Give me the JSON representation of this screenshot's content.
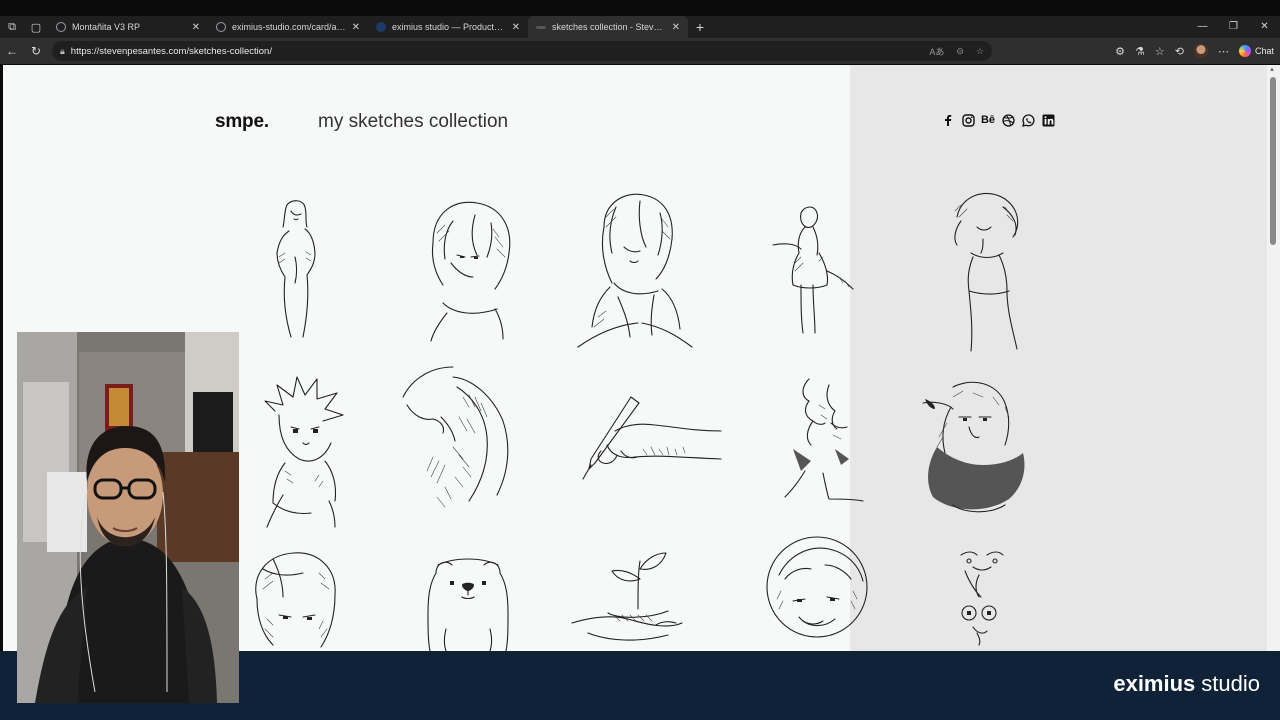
{
  "browser": {
    "tabs": [
      {
        "title": "Montañita V3 RP",
        "active": false,
        "favicon_color": "#9aa0a6"
      },
      {
        "title": "eximius-studio.com/card/app/car",
        "active": false,
        "favicon_color": "#9aa0a6"
      },
      {
        "title": "eximius studio — Productos digit",
        "active": false,
        "favicon_color": "#1d3b66"
      },
      {
        "title": "sketches collection - Steven Pesa",
        "active": true,
        "favicon_color": "#555555"
      }
    ],
    "new_tab": "+",
    "url": "https://stevenpesantes.com/sketches-collection/",
    "chat_label": "Chat"
  },
  "page": {
    "logo": "smpe.",
    "title": "my sketches collection",
    "social_icons": [
      "facebook-icon",
      "instagram-icon",
      "behance-icon",
      "dribbble-icon",
      "whatsapp-icon",
      "linkedin-icon"
    ],
    "behance_text": "Bē",
    "accent_right_panel": "#e7e7e7",
    "sketches": [
      "girl-standing-sketch",
      "short-hair-girl-sketch",
      "girl-collar-sketch",
      "girl-dress-back-sketch",
      "girl-dress-sketch",
      "spiky-hair-girl-sketch",
      "profile-kiss-sketch",
      "hand-pen-sketch",
      "faces-kiss-sketch",
      "old-wizard-sketch",
      "girl-portrait-sketch",
      "polar-bear-sketch",
      "hand-plant-sketch",
      "smiling-boy-sketch",
      "funny-faces-sketch"
    ]
  },
  "overlay": {
    "brand_mark": "e",
    "brand_bold": "ximius",
    "brand_light": "studio",
    "bar_color": "#0f2238"
  }
}
